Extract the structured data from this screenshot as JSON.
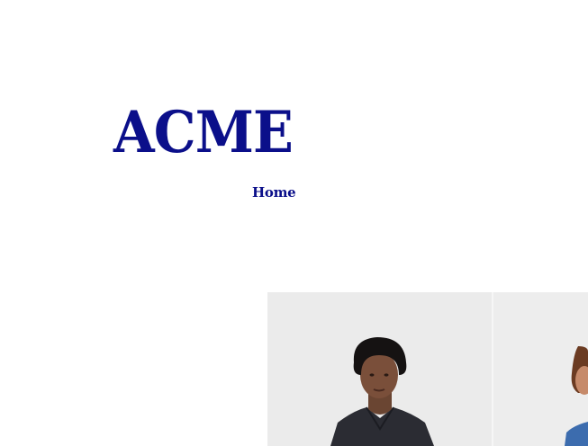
{
  "header": {
    "logo_text": "ACME"
  },
  "nav": {
    "home_label": "Home"
  },
  "hero": {
    "images": [
      {
        "name": "model-photo-1"
      },
      {
        "name": "model-photo-2"
      }
    ]
  }
}
